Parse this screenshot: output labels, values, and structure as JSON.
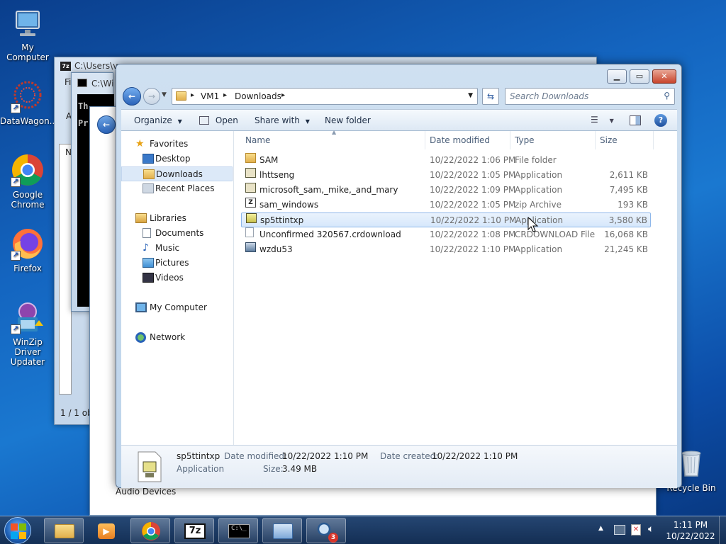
{
  "desktop_icons": [
    {
      "label": "My Computer",
      "icon": "computer-icon"
    },
    {
      "label": "DataWagon...",
      "icon": "datawagon-icon"
    },
    {
      "label": "Google Chrome",
      "icon": "chrome-icon"
    },
    {
      "label": "Firefox",
      "icon": "firefox-icon"
    },
    {
      "label": "WinZip Driver Updater",
      "icon": "winzip-driver-updater-icon"
    },
    {
      "label": "Recycle Bin",
      "icon": "recycle-bin-icon"
    }
  ],
  "background_windows": {
    "sevenzip_title": "C:\\Users\\vm",
    "sevenzip_menu_fragment": "Fi",
    "sevenzip_a": "A",
    "sevenzip_n": "N",
    "sevenzip_status": "1 / 1 ob",
    "cmd_title": "C:\\Wi",
    "cmd_line1": "Th",
    "cmd_line2": "Pr",
    "audio_label": "Audio Devices"
  },
  "explorer": {
    "breadcrumb": [
      "VM1",
      "Downloads"
    ],
    "search_placeholder": "Search Downloads",
    "toolbar": {
      "organize": "Organize",
      "open": "Open",
      "share_with": "Share with",
      "new_folder": "New folder"
    },
    "nav": {
      "favorites": "Favorites",
      "favorites_items": [
        "Desktop",
        "Downloads",
        "Recent Places"
      ],
      "libraries": "Libraries",
      "library_items": [
        "Documents",
        "Music",
        "Pictures",
        "Videos"
      ],
      "my_computer": "My Computer",
      "network": "Network"
    },
    "columns": {
      "name": "Name",
      "date": "Date modified",
      "type": "Type",
      "size": "Size"
    },
    "files": [
      {
        "name": "SAM",
        "date": "10/22/2022 1:06 PM",
        "type": "File folder",
        "size": "",
        "icon": "folder-icon"
      },
      {
        "name": "lhttseng",
        "date": "10/22/2022 1:05 PM",
        "type": "Application",
        "size": "2,611 KB",
        "icon": "installer-icon"
      },
      {
        "name": "microsoft_sam,_mike,_and_mary",
        "date": "10/22/2022 1:09 PM",
        "type": "Application",
        "size": "7,495 KB",
        "icon": "installer-icon"
      },
      {
        "name": "sam_windows",
        "date": "10/22/2022 1:05 PM",
        "type": "zip Archive",
        "size": "193 KB",
        "icon": "zip-archive-icon"
      },
      {
        "name": "sp5ttintxp",
        "date": "10/22/2022 1:10 PM",
        "type": "Application",
        "size": "3,580 KB",
        "icon": "setup-icon"
      },
      {
        "name": "Unconfirmed 320567.crdownload",
        "date": "10/22/2022 1:08 PM",
        "type": "CRDOWNLOAD File",
        "size": "16,068 KB",
        "icon": "file-icon"
      },
      {
        "name": "wzdu53",
        "date": "10/22/2022 1:10 PM",
        "type": "Application",
        "size": "21,245 KB",
        "icon": "app-icon"
      }
    ],
    "selected_index": 4,
    "details": {
      "name": "sp5ttintxp",
      "type": "Application",
      "date_modified_label": "Date modified:",
      "date_modified": "10/22/2022 1:10 PM",
      "date_created_label": "Date created:",
      "date_created": "10/22/2022 1:10 PM",
      "size_label": "Size:",
      "size": "3.49 MB"
    }
  },
  "taskbar": {
    "apps": [
      "Windows Explorer",
      "Windows Media Player",
      "Google Chrome",
      "7-Zip",
      "Command Prompt",
      "Control Panel",
      "Search"
    ],
    "badge": "3",
    "time": "1:11 PM",
    "date": "10/22/2022"
  },
  "colors": {
    "selection": "#d6e7fb",
    "link_text": "#1e3287"
  }
}
